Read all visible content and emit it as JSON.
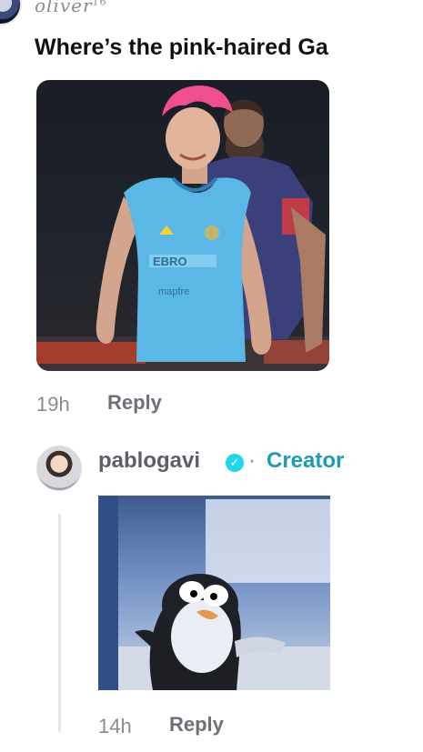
{
  "top_comment": {
    "username": "oliver",
    "username_suffix": "16",
    "text": "Where’s the pink-haired Ga",
    "time": "19h",
    "reply_label": "Reply"
  },
  "photo": {
    "jersey_sponsor": "EBRO",
    "jersey_sponsor_2": "mapfre"
  },
  "reply": {
    "username": "pablogavi",
    "separator": "·",
    "creator_badge": "Creator",
    "time": "14h",
    "reply_label": "Reply"
  },
  "colors": {
    "creator": "#1d9cb0",
    "verified": "#20d5ec",
    "muted": "#8a8b91"
  },
  "icons": {
    "verified": "verified-badge-icon"
  }
}
